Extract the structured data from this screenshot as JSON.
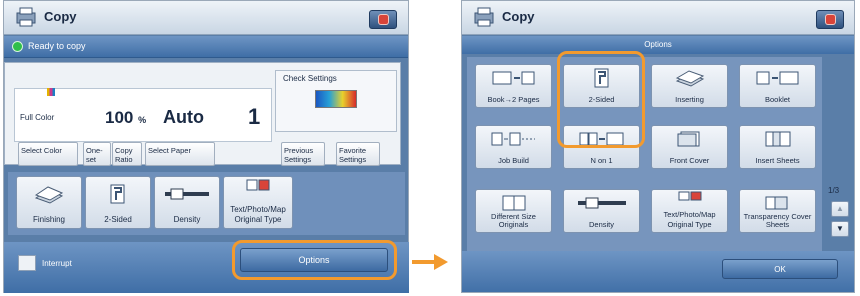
{
  "left_screen": {
    "title": "Copy",
    "status_text": "Ready to copy",
    "color_mode": "Full Color",
    "ratio_value": "100",
    "ratio_unit": "%",
    "paper": "Auto",
    "copies": "1",
    "check_settings": "Check Settings",
    "buttons": {
      "select_color": "Select Color",
      "one_to_one_line1": "One-",
      "one_to_one_line2": "set",
      "copy_ratio_line1": "Copy",
      "copy_ratio_line2": "Ratio",
      "select_paper": "Select Paper",
      "previous_line1": "Previous",
      "previous_line2": "Settings",
      "favorite_line1": "Favorite",
      "favorite_line2": "Settings"
    },
    "functions": [
      {
        "label": "Finishing",
        "icon": "finishing-icon"
      },
      {
        "label": "2-Sided",
        "icon": "two-sided-icon"
      },
      {
        "label": "Density",
        "icon": "density-icon"
      },
      {
        "label": "Text/Photo/Map",
        "label2": "Original Type",
        "icon": "original-type-icon"
      }
    ],
    "interrupt": "Interrupt",
    "options_button": "Options"
  },
  "right_screen": {
    "title": "Copy",
    "header": "Options",
    "options": [
      {
        "label": "Book→2 Pages",
        "icon": "book-to-two-pages-icon"
      },
      {
        "label": "2-Sided",
        "icon": "two-sided-icon"
      },
      {
        "label": "Inserting",
        "icon": "inserting-icon"
      },
      {
        "label": "Booklet",
        "icon": "booklet-icon"
      },
      {
        "label": "Job Build",
        "icon": "job-build-icon"
      },
      {
        "label": "N on 1",
        "icon": "n-on-1-icon"
      },
      {
        "label": "Front Cover",
        "icon": "front-cover-icon"
      },
      {
        "label": "Insert Sheets",
        "icon": "insert-sheets-icon"
      },
      {
        "label": "Different Size Originals",
        "icon": "different-size-originals-icon"
      },
      {
        "label": "Density",
        "icon": "density-icon"
      },
      {
        "label": "Original Type",
        "sub": "Text/Photo/Map",
        "icon": "original-type-icon"
      },
      {
        "label": "Transparency Cover Sheets",
        "icon": "transparency-cover-sheets-icon"
      }
    ],
    "page_indicator": "1/3",
    "ok_button": "OK"
  },
  "colors": {
    "highlight": "#f29a2e",
    "screen_bg": "#5a7ea8",
    "button_blue": "#3d6aa2"
  }
}
